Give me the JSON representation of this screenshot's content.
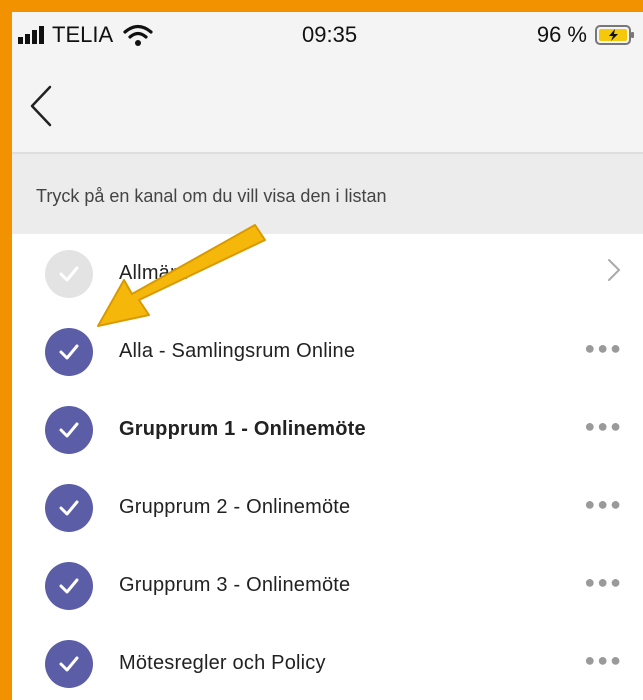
{
  "status_bar": {
    "carrier": "TELIA",
    "time": "09:35",
    "battery": "96 %"
  },
  "hint": "Tryck på en kanal om du vill visa den i listan",
  "channels": [
    {
      "label": "Allmänt",
      "checked": true,
      "disabled": true,
      "bold": false,
      "action": "chevron-right-icon"
    },
    {
      "label": "Alla - Samlingsrum Online",
      "checked": true,
      "disabled": false,
      "bold": false,
      "action": "more-options-icon"
    },
    {
      "label": "Grupprum 1 - Onlinemöte",
      "checked": true,
      "disabled": false,
      "bold": true,
      "action": "more-options-icon"
    },
    {
      "label": "Grupprum 2 - Onlinemöte",
      "checked": true,
      "disabled": false,
      "bold": false,
      "action": "more-options-icon"
    },
    {
      "label": "Grupprum 3 - Onlinemöte",
      "checked": true,
      "disabled": false,
      "bold": false,
      "action": "more-options-icon"
    },
    {
      "label": "Mötesregler och Policy",
      "checked": true,
      "disabled": false,
      "bold": false,
      "action": "more-options-icon"
    }
  ],
  "colors": {
    "frame": "#F39200",
    "check": "#5B5EA6",
    "arrow": "#F5B70A"
  }
}
